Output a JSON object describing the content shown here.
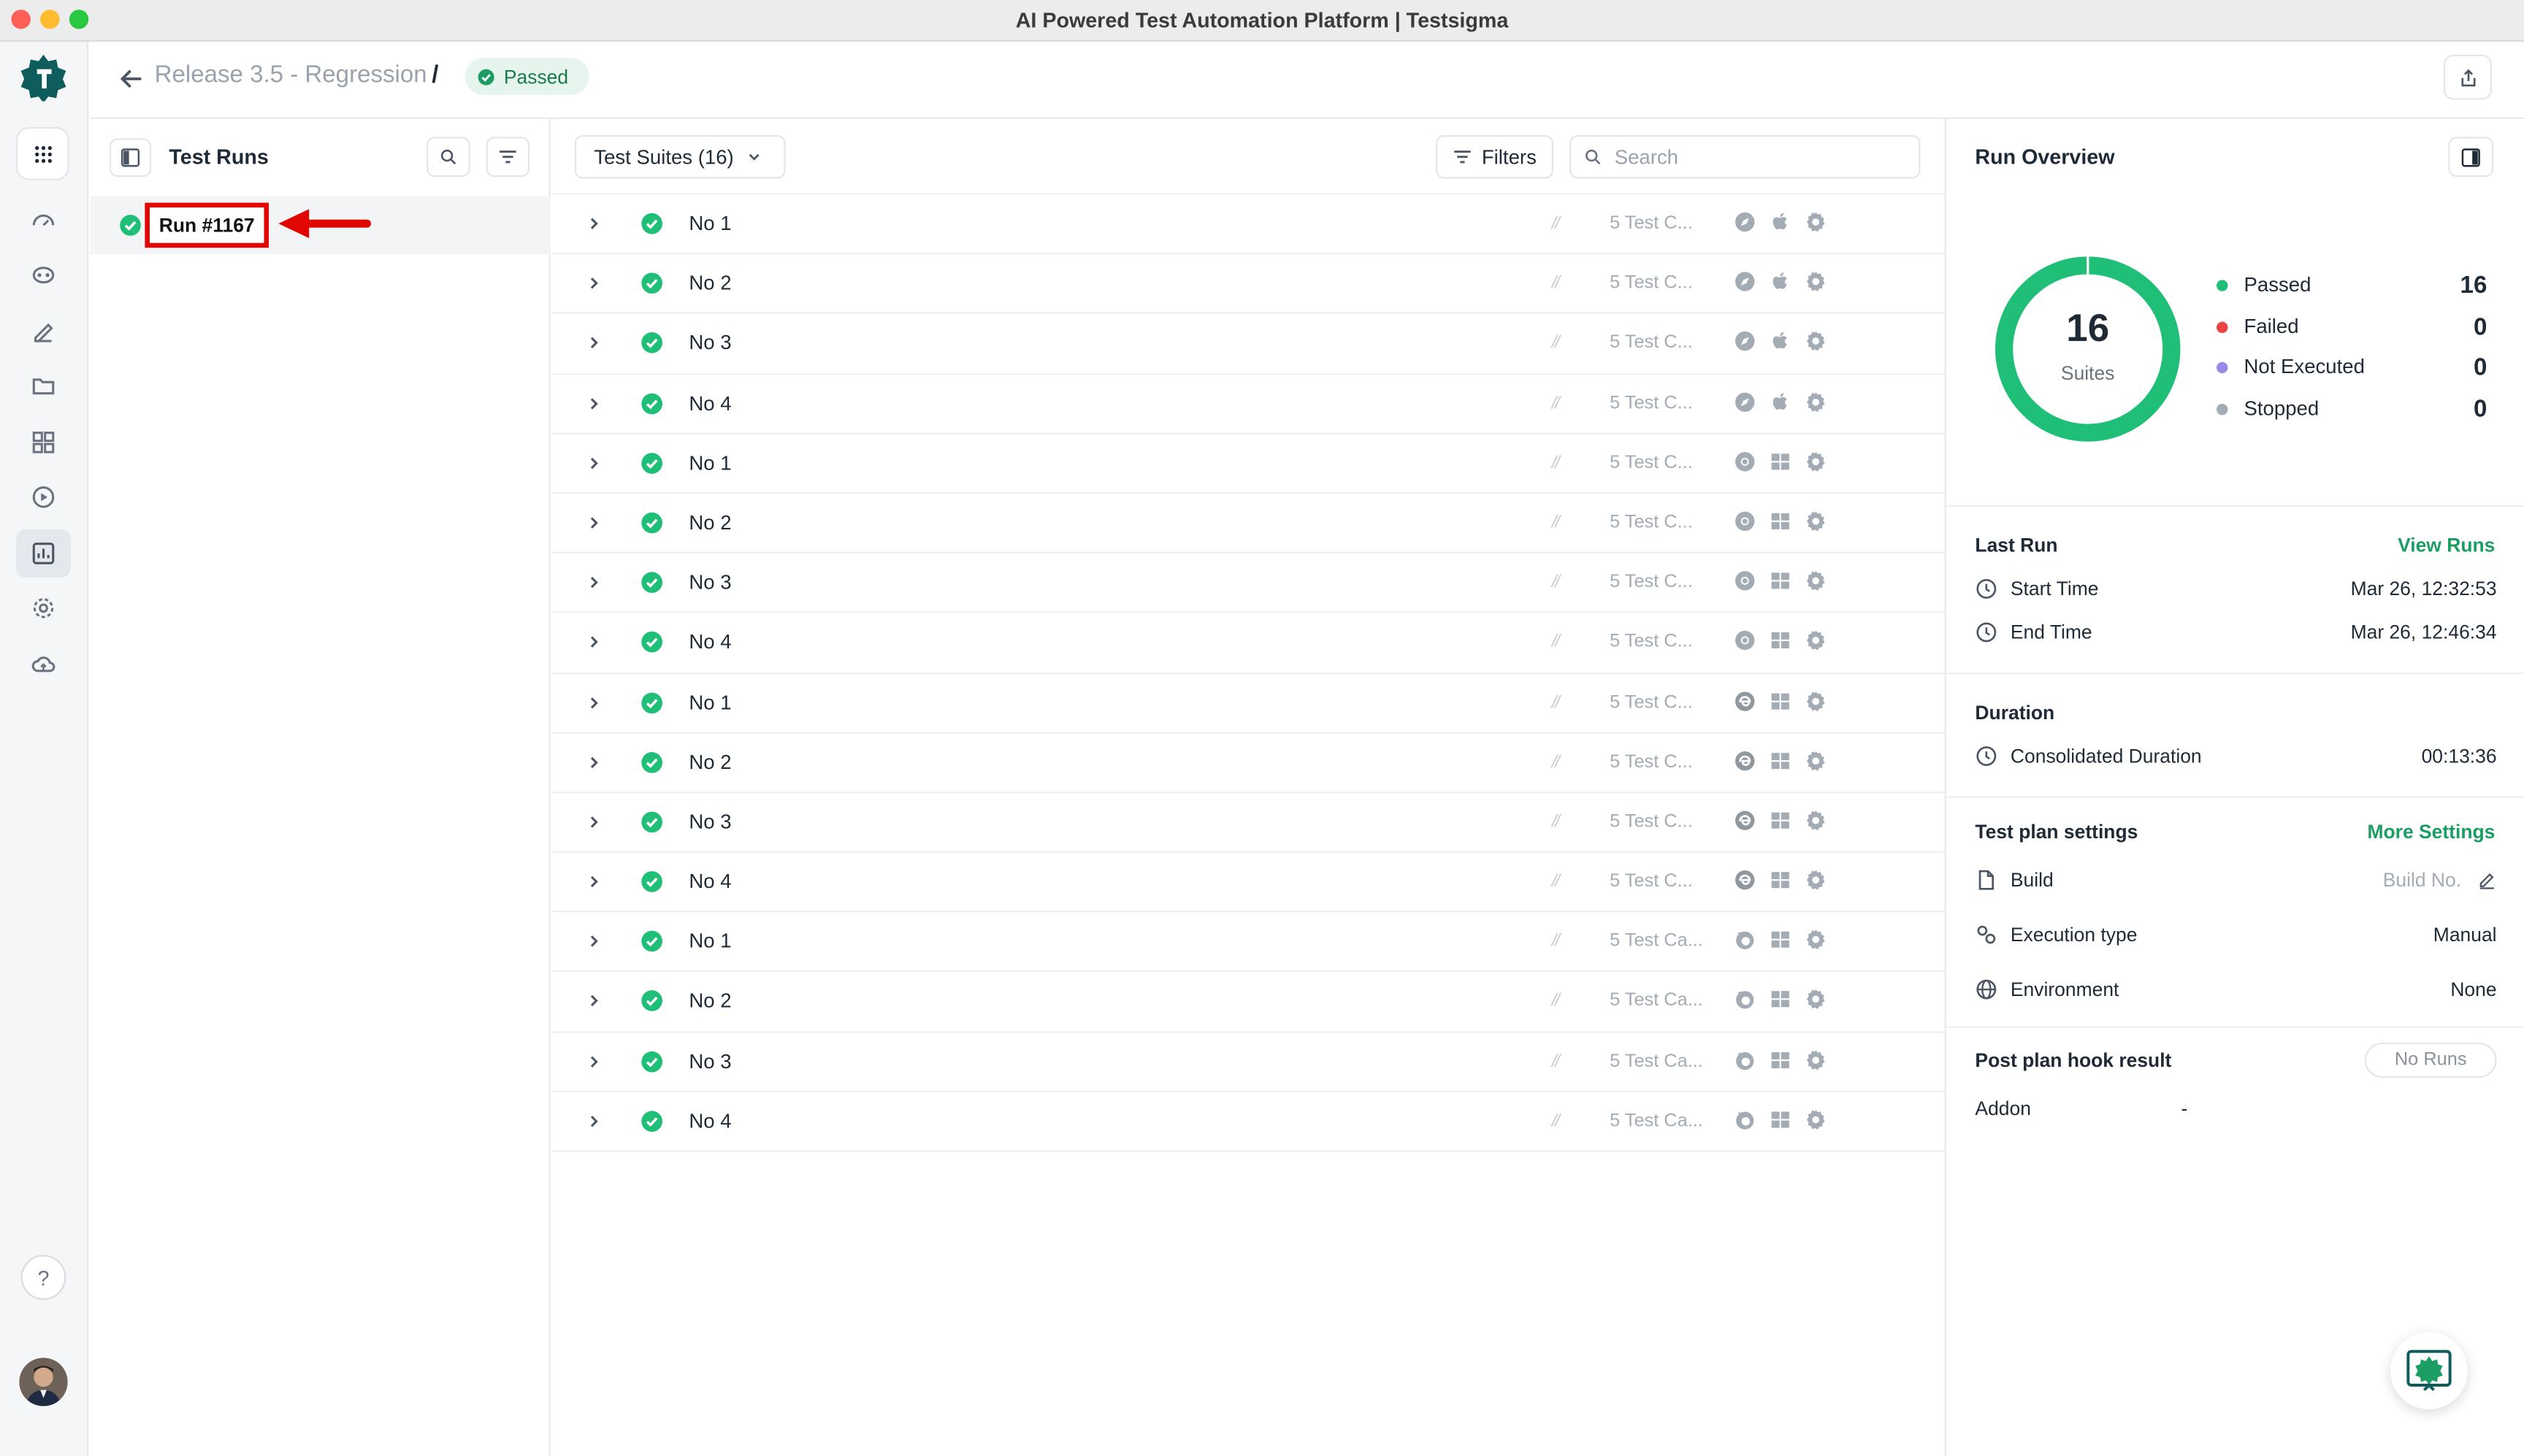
{
  "window": {
    "title": "AI Powered Test Automation Platform | Testsigma"
  },
  "header": {
    "breadcrumb": "Release 3.5 - Regression",
    "breadcrumb_sep": "/",
    "status": "Passed"
  },
  "runs_panel": {
    "title": "Test Runs",
    "selected_run": "Run #1167"
  },
  "suites_panel": {
    "dropdown_label": "Test Suites (16)",
    "filters_label": "Filters",
    "search_placeholder": "Search",
    "rows": [
      {
        "name": "No 1",
        "count": "5 Test C...",
        "browser": "safari-icon",
        "os": "apple-icon"
      },
      {
        "name": "No 2",
        "count": "5 Test C...",
        "browser": "safari-icon",
        "os": "apple-icon"
      },
      {
        "name": "No 3",
        "count": "5 Test C...",
        "browser": "safari-icon",
        "os": "apple-icon"
      },
      {
        "name": "No 4",
        "count": "5 Test C...",
        "browser": "safari-icon",
        "os": "apple-icon"
      },
      {
        "name": "No 1",
        "count": "5 Test C...",
        "browser": "chrome-icon",
        "os": "windows-icon"
      },
      {
        "name": "No 2",
        "count": "5 Test C...",
        "browser": "chrome-icon",
        "os": "windows-icon"
      },
      {
        "name": "No 3",
        "count": "5 Test C...",
        "browser": "chrome-icon",
        "os": "windows-icon"
      },
      {
        "name": "No 4",
        "count": "5 Test C...",
        "browser": "chrome-icon",
        "os": "windows-icon"
      },
      {
        "name": "No 1",
        "count": "5 Test C...",
        "browser": "edge-icon",
        "os": "windows-icon"
      },
      {
        "name": "No 2",
        "count": "5 Test C...",
        "browser": "edge-icon",
        "os": "windows-icon"
      },
      {
        "name": "No 3",
        "count": "5 Test C...",
        "browser": "edge-icon",
        "os": "windows-icon"
      },
      {
        "name": "No 4",
        "count": "5 Test C...",
        "browser": "edge-icon",
        "os": "windows-icon"
      },
      {
        "name": "No 1",
        "count": "5 Test Ca...",
        "browser": "firefox-icon",
        "os": "windows-icon"
      },
      {
        "name": "No 2",
        "count": "5 Test Ca...",
        "browser": "firefox-icon",
        "os": "windows-icon"
      },
      {
        "name": "No 3",
        "count": "5 Test Ca...",
        "browser": "firefox-icon",
        "os": "windows-icon"
      },
      {
        "name": "No 4",
        "count": "5 Test Ca...",
        "browser": "firefox-icon",
        "os": "windows-icon"
      }
    ]
  },
  "overview": {
    "title": "Run Overview",
    "donut_total": "16",
    "donut_label": "Suites",
    "legend": [
      {
        "label": "Passed",
        "value": "16",
        "color": "#1fbf77"
      },
      {
        "label": "Failed",
        "value": "0",
        "color": "#ef4444"
      },
      {
        "label": "Not Executed",
        "value": "0",
        "color": "#9b87e6"
      },
      {
        "label": "Stopped",
        "value": "0",
        "color": "#a3abb4"
      }
    ],
    "last_run": {
      "label": "Last Run",
      "link": "View Runs",
      "start_label": "Start Time",
      "start_value": "Mar 26, 12:32:53",
      "end_label": "End Time",
      "end_value": "Mar 26, 12:46:34"
    },
    "duration": {
      "label": "Duration",
      "consolidated_label": "Consolidated Duration",
      "consolidated_value": "00:13:36"
    },
    "settings": {
      "label": "Test plan settings",
      "link": "More Settings",
      "build_label": "Build",
      "build_value": "Build No.",
      "exec_label": "Execution type",
      "exec_value": "Manual",
      "env_label": "Environment",
      "env_value": "None"
    },
    "hook": {
      "label": "Post plan hook result",
      "button": "No Runs",
      "addon_label": "Addon",
      "addon_value": "-"
    }
  },
  "colors": {
    "accent": "#1b9e63",
    "pass": "#1fbf77",
    "annotation": "#e10600"
  }
}
